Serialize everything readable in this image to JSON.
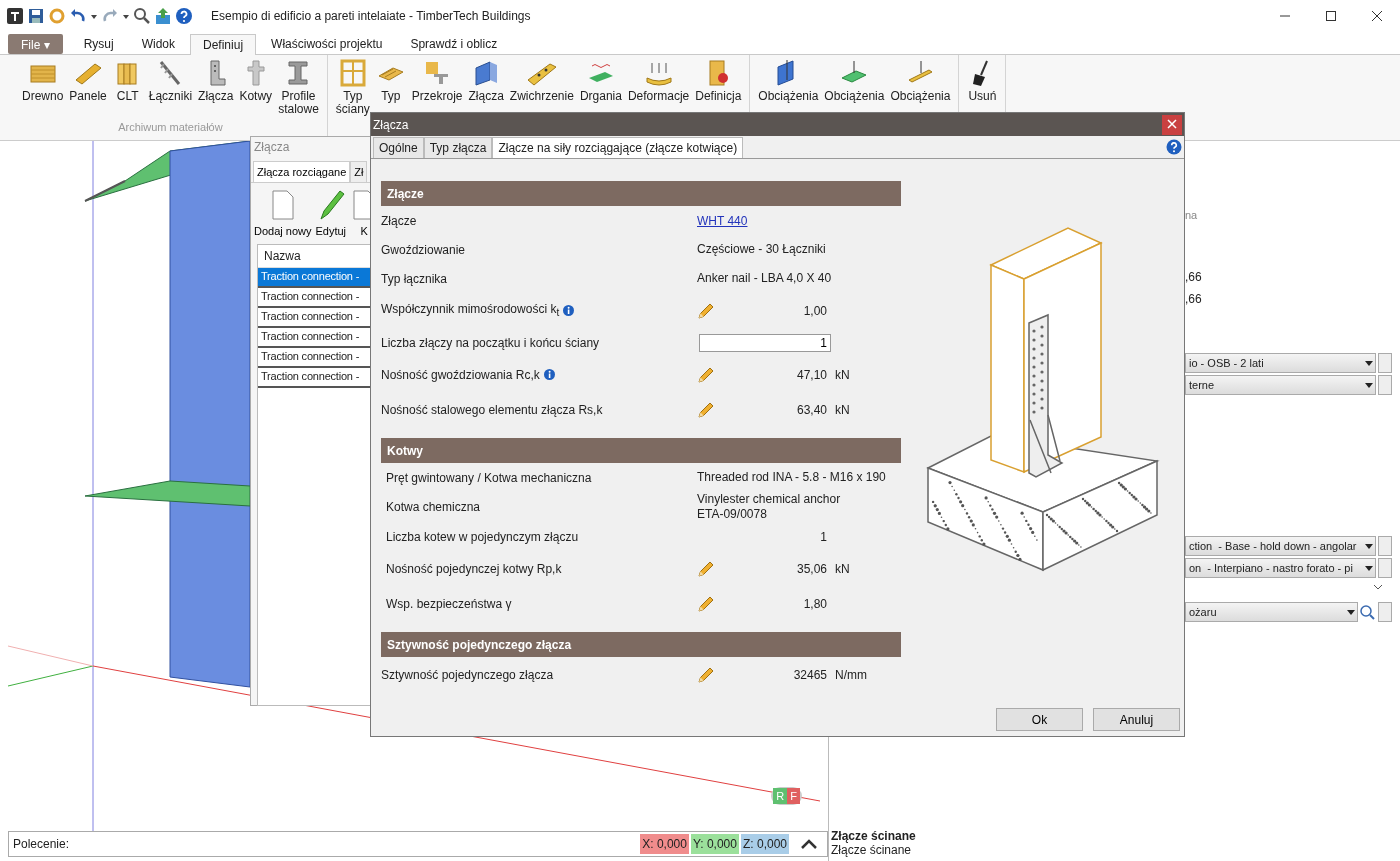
{
  "window": {
    "title": "Esempio di edificio a pareti intelaiate - TimberTech Buildings"
  },
  "menu_tabs": [
    {
      "label": "File ▾",
      "kind": "file",
      "selected": false
    },
    {
      "label": "Rysuj",
      "kind": "tab",
      "selected": false
    },
    {
      "label": "Widok",
      "kind": "tab",
      "selected": false
    },
    {
      "label": "Definiuj",
      "kind": "tab",
      "selected": true
    },
    {
      "label": "Właściwości projektu",
      "kind": "tab",
      "selected": false
    },
    {
      "label": "Sprawdź i oblicz",
      "kind": "tab",
      "selected": false
    }
  ],
  "ribbon": {
    "groups": [
      {
        "label": "Archiwum materiałów",
        "items": [
          {
            "label": "Drewno"
          },
          {
            "label": "Panele"
          },
          {
            "label": "CLT"
          },
          {
            "label": "Łączniki"
          },
          {
            "label": "Złącza"
          },
          {
            "label": "Kotwy"
          },
          {
            "label": "Profile\nstalowe"
          }
        ]
      },
      {
        "items": [
          {
            "label": "Typ\nściany"
          },
          {
            "label": "Typ"
          },
          {
            "label": "Przekroje"
          },
          {
            "label": "Złącza"
          },
          {
            "label": "Zwichrzenie"
          },
          {
            "label": "Drgania"
          },
          {
            "label": "Deformacje"
          },
          {
            "label": "Definicja"
          }
        ]
      },
      {
        "items": [
          {
            "label": "Obciążenia"
          },
          {
            "label": "Obciążenia"
          },
          {
            "label": "Obciążenia"
          }
        ]
      },
      {
        "items": [
          {
            "label": "Usuń"
          }
        ]
      }
    ]
  },
  "viewport": {
    "view_cube": [
      "R",
      "F"
    ]
  },
  "connections_panel": {
    "title": "Złącza",
    "tabs": [
      {
        "label": "Złącza rozciągane",
        "selected": true
      },
      {
        "label": "Zł",
        "selected": false
      }
    ],
    "tools": [
      {
        "label": "Dodaj nowy"
      },
      {
        "label": "Edytuj"
      },
      {
        "label": "K"
      }
    ],
    "columns": [
      "Nazwa"
    ],
    "rows": [
      {
        "name": "Traction connection -",
        "selected": true
      },
      {
        "name": "Traction connection -",
        "selected": false
      },
      {
        "name": "Traction connection -",
        "selected": false
      },
      {
        "name": "Traction connection -",
        "selected": false
      },
      {
        "name": "Traction connection -",
        "selected": false
      },
      {
        "name": "Traction connection -",
        "selected": false
      }
    ]
  },
  "properties_panel": {
    "groups": [
      [
        {
          "kind": "hint",
          "text": "na"
        }
      ],
      [
        {
          "kind": "text",
          "text": ",66"
        },
        {
          "kind": "text",
          "text": ",66"
        }
      ],
      [
        {
          "kind": "select",
          "text": "io - OSB - 2 lati"
        },
        {
          "kind": "select",
          "text": "terne"
        }
      ],
      [
        {
          "kind": "select",
          "text": "ction  - Base - hold down - angolar"
        },
        {
          "kind": "select",
          "text": "on  - Interpiano - nastro forato - pi"
        },
        {
          "kind": "collapse"
        },
        {
          "kind": "search",
          "text": "ożaru"
        }
      ]
    ],
    "footer_title": "Złącze ścinane",
    "footer_text": "Złącze ścinane"
  },
  "status_bar": {
    "command_label": "Polecenie:",
    "coords": [
      {
        "text": "X: 0,000",
        "color": "#f08c8c"
      },
      {
        "text": "Y: 0,000",
        "color": "#9be09b"
      },
      {
        "text": "Z: 0,000",
        "color": "#a9cde8"
      }
    ]
  },
  "dialog": {
    "title": "Złącza",
    "tabs": [
      {
        "label": "Ogólne",
        "selected": false
      },
      {
        "label": "Typ złącza",
        "selected": false
      },
      {
        "label": "Złącze na siły rozciągające (złącze kotwiące)",
        "selected": true
      }
    ],
    "sections": [
      {
        "title": "Złącze",
        "rows": [
          {
            "kind": "link",
            "label": "Złącze",
            "value": "WHT 440"
          },
          {
            "kind": "text",
            "label": "Gwoździowanie",
            "value": "Częściowe - 30 Łączniki"
          },
          {
            "kind": "text",
            "label": "Typ łącznika",
            "value": "Anker nail - LBA 4,0 X 40"
          },
          {
            "kind": "edit",
            "label": "Współczynnik mimośrodowości  k$_{t}$",
            "info": true,
            "value": "1,00"
          },
          {
            "kind": "input",
            "label": "Liczba złączy na początku i końcu ściany",
            "value": "1"
          },
          {
            "kind": "edit",
            "label": "Nośność gwoździowania Rc,k",
            "info": true,
            "value": "47,10",
            "unit": "kN"
          },
          {
            "kind": "edit",
            "label": "Nośność stalowego elementu złącza Rs,k",
            "value": "63,40",
            "unit": "kN"
          }
        ]
      },
      {
        "title": "Kotwy",
        "rows": [
          {
            "kind": "text",
            "label": "Pręt gwintowany / Kotwa mechaniczna",
            "value": "Threaded rod INA - 5.8 - M16 x 190"
          },
          {
            "kind": "text",
            "label": "Kotwa chemiczna",
            "value": "Vinylester chemical anchor\nETA-09/0078"
          },
          {
            "kind": "number",
            "label": "Liczba kotew w pojedynczym złączu",
            "value": "1"
          },
          {
            "kind": "edit",
            "label": "Nośność pojedynczej kotwy Rp,k",
            "value": "35,06",
            "unit": "kN"
          },
          {
            "kind": "edit",
            "label": "Wsp. bezpieczeństwa γ",
            "value": "1,80"
          }
        ]
      },
      {
        "title": "Sztywność pojedynczego złącza",
        "rows": [
          {
            "kind": "edit",
            "label": "Sztywność pojedynczego złącza",
            "value": "32465",
            "unit": "N/mm"
          }
        ]
      }
    ],
    "buttons": [
      "Ok",
      "Anuluj"
    ]
  }
}
